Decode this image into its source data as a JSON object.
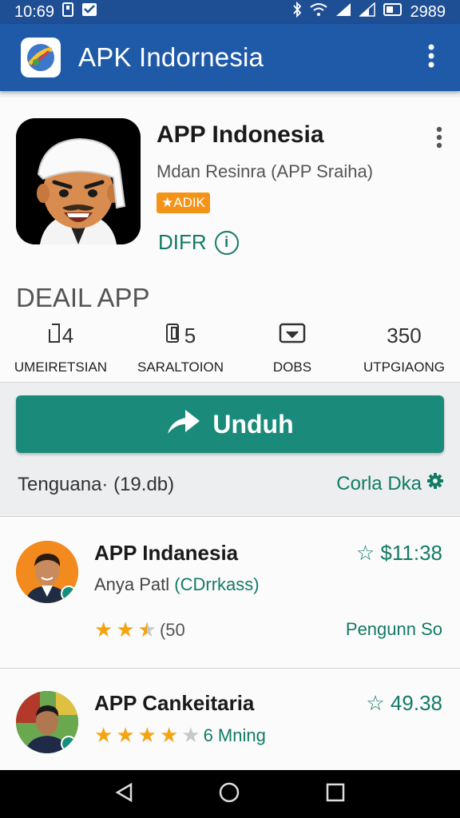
{
  "status_bar": {
    "time": "10:69",
    "battery": "2989"
  },
  "app_bar": {
    "title": "APK Indornesia"
  },
  "app": {
    "name": "APP Indonesia",
    "developer": "Mdan Resinra (APP Sraiha)",
    "badge": "★ADIK",
    "link": "DIFR"
  },
  "details": {
    "title": "DEAIL APP",
    "stats": [
      {
        "value": "4",
        "label": "UMEIRETSIAN",
        "icon": "phone-icon"
      },
      {
        "value": "5",
        "label": "SARALTOION",
        "icon": "document-icon"
      },
      {
        "value": "",
        "label": "DOBS",
        "icon": "inbox-download-icon"
      },
      {
        "value": "350",
        "label": "UTPGIAONG",
        "icon": ""
      }
    ]
  },
  "download": {
    "label": "Unduh",
    "size": "Tenguana· (19.db)",
    "more": "Corla Dka"
  },
  "list": [
    {
      "name": "APP Indanesia",
      "price": "☆ $11:38",
      "sub": "Anya Patl",
      "sub_accent": "(CDrrkass)",
      "rating_count": "(50",
      "right_label": "Pengunn So",
      "stars_filled": 2.5
    },
    {
      "name": "APP Cankeitaria",
      "price": "☆ 49.38",
      "rating_label": "6 Mning",
      "stars_filled": 4
    }
  ],
  "colors": {
    "accent": "#1a8a7a",
    "appbar": "#1f5aa8",
    "badge": "#f39418",
    "star": "#f2a413"
  }
}
